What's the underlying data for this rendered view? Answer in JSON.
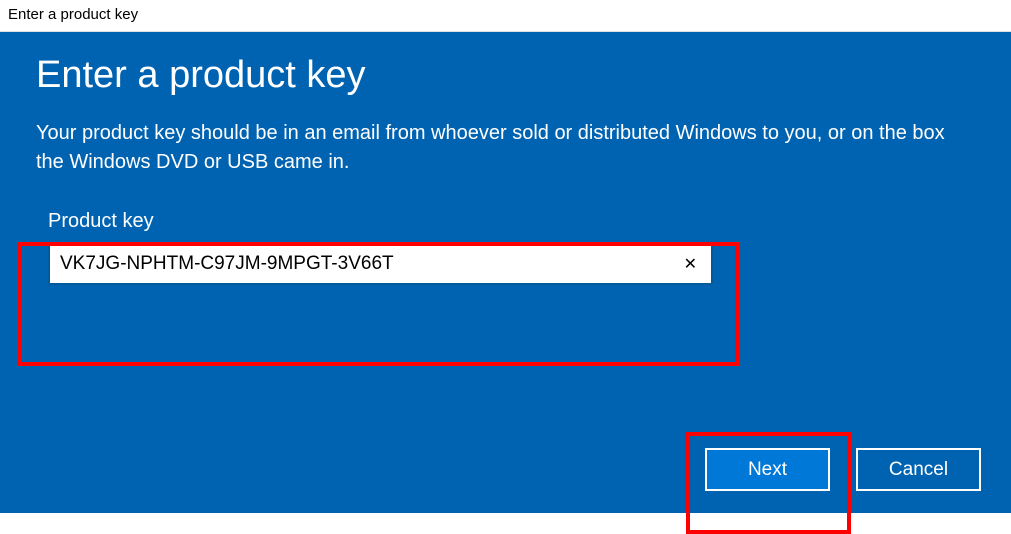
{
  "window": {
    "title": "Enter a product key"
  },
  "dialog": {
    "heading": "Enter a product key",
    "description": "Your product key should be in an email from whoever sold or distributed Windows to you, or on the box the Windows DVD or USB came in.",
    "field_label": "Product key",
    "product_key_value": "VK7JG-NPHTM-C97JM-9MPGT-3V66T",
    "clear_glyph": "✕",
    "next_label": "Next",
    "cancel_label": "Cancel"
  },
  "colors": {
    "dialog_bg": "#0063b1",
    "accent": "#0078d7",
    "highlight": "#ff0000"
  }
}
